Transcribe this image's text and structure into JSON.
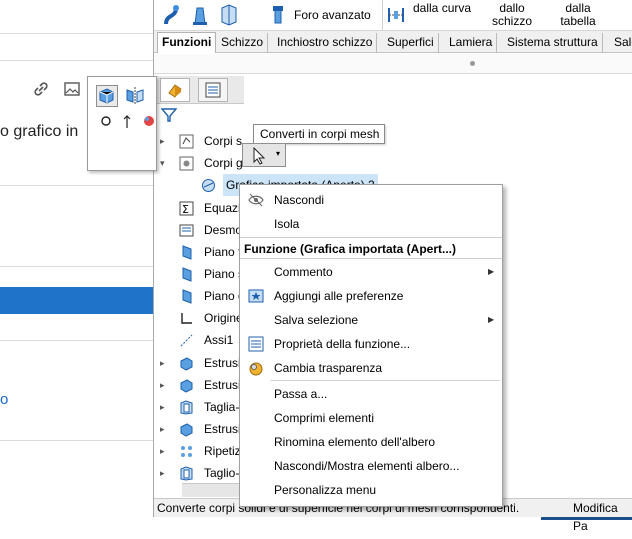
{
  "background": {
    "text_fragment": "o grafico in",
    "link_fragment": "o"
  },
  "toolbar": {
    "foro_avanzato": "Foro avanzato",
    "dalla_curva": "dalla curva",
    "dallo_schizzo_1": "dallo",
    "dallo_schizzo_2": "schizzo",
    "dalla_tabella_1": "dalla",
    "dalla_tabella_2": "tabella"
  },
  "tabs": [
    {
      "label": "Funzioni"
    },
    {
      "label": "Schizzo"
    },
    {
      "label": "Inchiostro schizzo"
    },
    {
      "label": "Superfici"
    },
    {
      "label": "Lamiera"
    },
    {
      "label": "Sistema struttura"
    },
    {
      "label": "Saldat"
    }
  ],
  "tree": [
    {
      "label": "Corpi s",
      "expander": "▸"
    },
    {
      "label": "Corpi g",
      "expander": "▾"
    },
    {
      "label": "Grafica importata (Aperto) 2",
      "expander": ""
    },
    {
      "label": "Equazio",
      "expander": ""
    },
    {
      "label": "Desmo",
      "expander": ""
    },
    {
      "label": "Piano f",
      "expander": ""
    },
    {
      "label": "Piano s",
      "expander": ""
    },
    {
      "label": "Piano d",
      "expander": ""
    },
    {
      "label": "Origine",
      "expander": ""
    },
    {
      "label": "Assi1",
      "expander": ""
    },
    {
      "label": "Estrusio",
      "expander": "▸"
    },
    {
      "label": "Estrusio",
      "expander": "▸"
    },
    {
      "label": "Taglia-",
      "expander": "▸"
    },
    {
      "label": "Estrusio",
      "expander": "▸"
    },
    {
      "label": "Ripetiz",
      "expander": "▸"
    },
    {
      "label": "Taglio-",
      "expander": "▸"
    }
  ],
  "tooltip": "Converti in corpi mesh",
  "context_menu": {
    "hide": "Nascondi",
    "isolate": "Isola",
    "header": "Funzione (Grafica importata (Apert...)",
    "items": [
      {
        "label": "Commento",
        "submenu": true
      },
      {
        "label": "Aggiungi alle preferenze",
        "submenu": false
      },
      {
        "label": "Salva selezione",
        "submenu": true
      },
      {
        "label": "Proprietà della funzione...",
        "submenu": false
      },
      {
        "label": "Cambia trasparenza",
        "submenu": false
      },
      {
        "label": "Passa a...",
        "submenu": false
      },
      {
        "label": "Comprimi elementi",
        "submenu": false
      },
      {
        "label": "Rinomina elemento dell'albero",
        "submenu": false
      },
      {
        "label": "Nascondi/Mostra elementi albero...",
        "submenu": false
      },
      {
        "label": "Personalizza menu",
        "submenu": false
      }
    ]
  },
  "status_bar": {
    "message": "Converte corpi solidi e di superficie nei corpi di mesh corrispondenti.",
    "right": "Modifica Pa"
  },
  "colors": {
    "accent_blue": "#1f73c9",
    "selection_blue": "#cce4f7"
  }
}
